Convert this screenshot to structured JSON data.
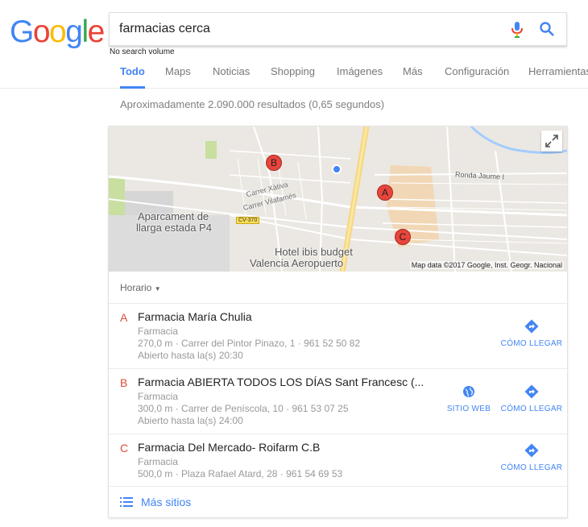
{
  "header": {
    "logo_letters": [
      {
        "ch": "G",
        "color": "#4285f4"
      },
      {
        "ch": "o",
        "color": "#ea4335"
      },
      {
        "ch": "o",
        "color": "#fbbc05"
      },
      {
        "ch": "g",
        "color": "#4285f4"
      },
      {
        "ch": "l",
        "color": "#34a853"
      },
      {
        "ch": "e",
        "color": "#ea4335"
      }
    ],
    "search_value": "farmacias cerca",
    "mic_icon": "microphone-icon",
    "search_icon": "magnifier-icon",
    "volume_note": "No search volume"
  },
  "tabs": [
    "Todo",
    "Maps",
    "Noticias",
    "Shopping",
    "Imágenes",
    "Más",
    "Configuración",
    "Herramientas"
  ],
  "active_tab": "Todo",
  "stats": "Aproximadamente 2.090.000 resultados (0,65 segundos)",
  "map": {
    "labels": {
      "ronda": "Ronda Jaume I",
      "xativa": "Carrer Xàtiva",
      "vilafames": "Carrer Vilafamés",
      "road": "CV-370",
      "parking1": "Aparcament de",
      "parking2": "llarga estada P4",
      "hotel1": "Hotel ibis budget",
      "hotel2": "Valencia Aeropuerto"
    },
    "pins": [
      "A",
      "B",
      "C"
    ],
    "credit": "Map data ©2017 Google, Inst. Geogr. Nacional",
    "expand_icon": "expand-icon"
  },
  "filter": "Horario",
  "results": [
    {
      "letter": "A",
      "name": "Farmacia María Chulia",
      "type": "Farmacia",
      "address": "270,0 m · Carrer del Pintor Pinazo, 1 · 961 52 50 82",
      "hours": "Abierto hasta la(s) 20:30",
      "directions": "CÓMO LLEGAR"
    },
    {
      "letter": "B",
      "name": "Farmacia ABIERTA TODOS LOS DÍAS Sant Francesc (...",
      "type": "Farmacia",
      "address": "300,0 m · Carrer de Peníscola, 10 · 961 53 07 25",
      "hours": "Abierto hasta la(s) 24:00",
      "website": "SITIO WEB",
      "directions": "CÓMO LLEGAR"
    },
    {
      "letter": "C",
      "name": "Farmacia Del Mercado- Roifarm C.B",
      "type": "Farmacia",
      "address": "500,0 m · Plaza Rafael Atard, 28 · 961 54 69 53",
      "directions": "CÓMO LLEGAR"
    }
  ],
  "more_sites": "Más sitios",
  "colors": {
    "accent": "#4285f4",
    "letter": "#dd4b39",
    "pin": "#e8453c"
  }
}
